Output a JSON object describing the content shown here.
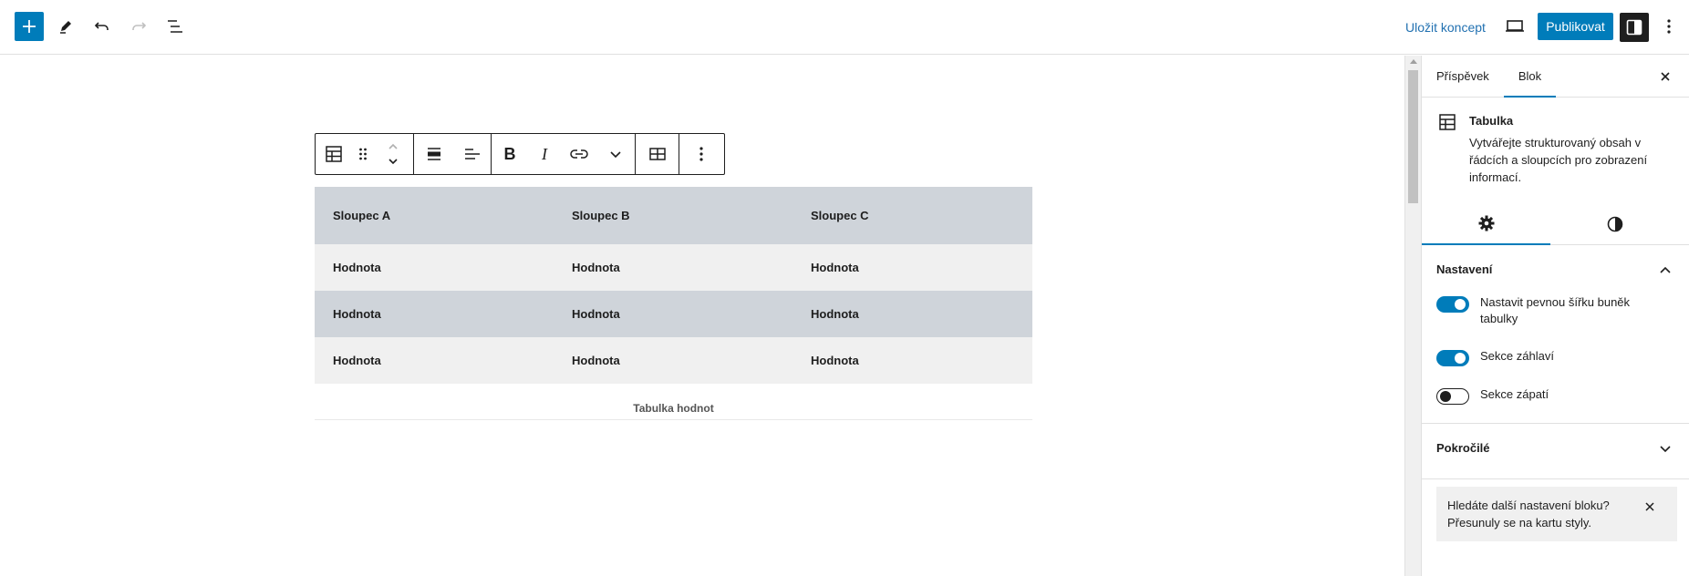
{
  "topbar": {
    "add_icon": "plus-icon",
    "tools_icon": "pencil-icon",
    "undo_icon": "undo-icon",
    "redo_icon": "redo-icon",
    "outline_icon": "list-view-icon",
    "save_label": "Uložit koncept",
    "preview_icon": "desktop-icon",
    "publish_label": "Publikovat",
    "settings_icon": "sidebar-icon",
    "more_icon": "vertical-dots-icon"
  },
  "block_toolbar": {
    "icons": [
      "table-icon",
      "drag-handle-icon",
      "move-up-icon",
      "move-down-icon",
      "align-wide-icon",
      "text-align-left-icon",
      "bold-icon",
      "italic-icon",
      "link-icon",
      "chevron-down-icon",
      "edit-table-icon",
      "vertical-dots-icon"
    ],
    "bold_label": "B",
    "italic_label": "I"
  },
  "table": {
    "headers": [
      "Sloupec A",
      "Sloupec B",
      "Sloupec C"
    ],
    "rows": [
      [
        "Hodnota",
        "Hodnota",
        "Hodnota"
      ],
      [
        "Hodnota",
        "Hodnota",
        "Hodnota"
      ],
      [
        "Hodnota",
        "Hodnota",
        "Hodnota"
      ]
    ],
    "caption": "Tabulka hodnot"
  },
  "sidebar": {
    "tabs": [
      {
        "label": "Příspěvek",
        "active": false
      },
      {
        "label": "Blok",
        "active": true
      }
    ],
    "block": {
      "icon": "table-icon",
      "title": "Tabulka",
      "description": "Vytvářejte strukturovaný obsah v řádcích a sloupcích pro zobrazení informací."
    },
    "subtabs": [
      {
        "icon": "gear-icon",
        "active": true
      },
      {
        "icon": "styles-icon",
        "active": false
      }
    ],
    "settings_panel": {
      "title": "Nastavení",
      "toggles": [
        {
          "label": "Nastavit pevnou šířku buněk tabulky",
          "on": true
        },
        {
          "label": "Sekce záhlaví",
          "on": true
        },
        {
          "label": "Sekce zápatí",
          "on": false
        }
      ]
    },
    "advanced_panel": {
      "title": "Pokročilé"
    },
    "notice": "Hledáte další nastavení bloku? Přesunuly se na kartu styly."
  },
  "colors": {
    "accent": "#007cba",
    "header_row": "#cfd4da",
    "row_light": "#f0f0f0"
  }
}
